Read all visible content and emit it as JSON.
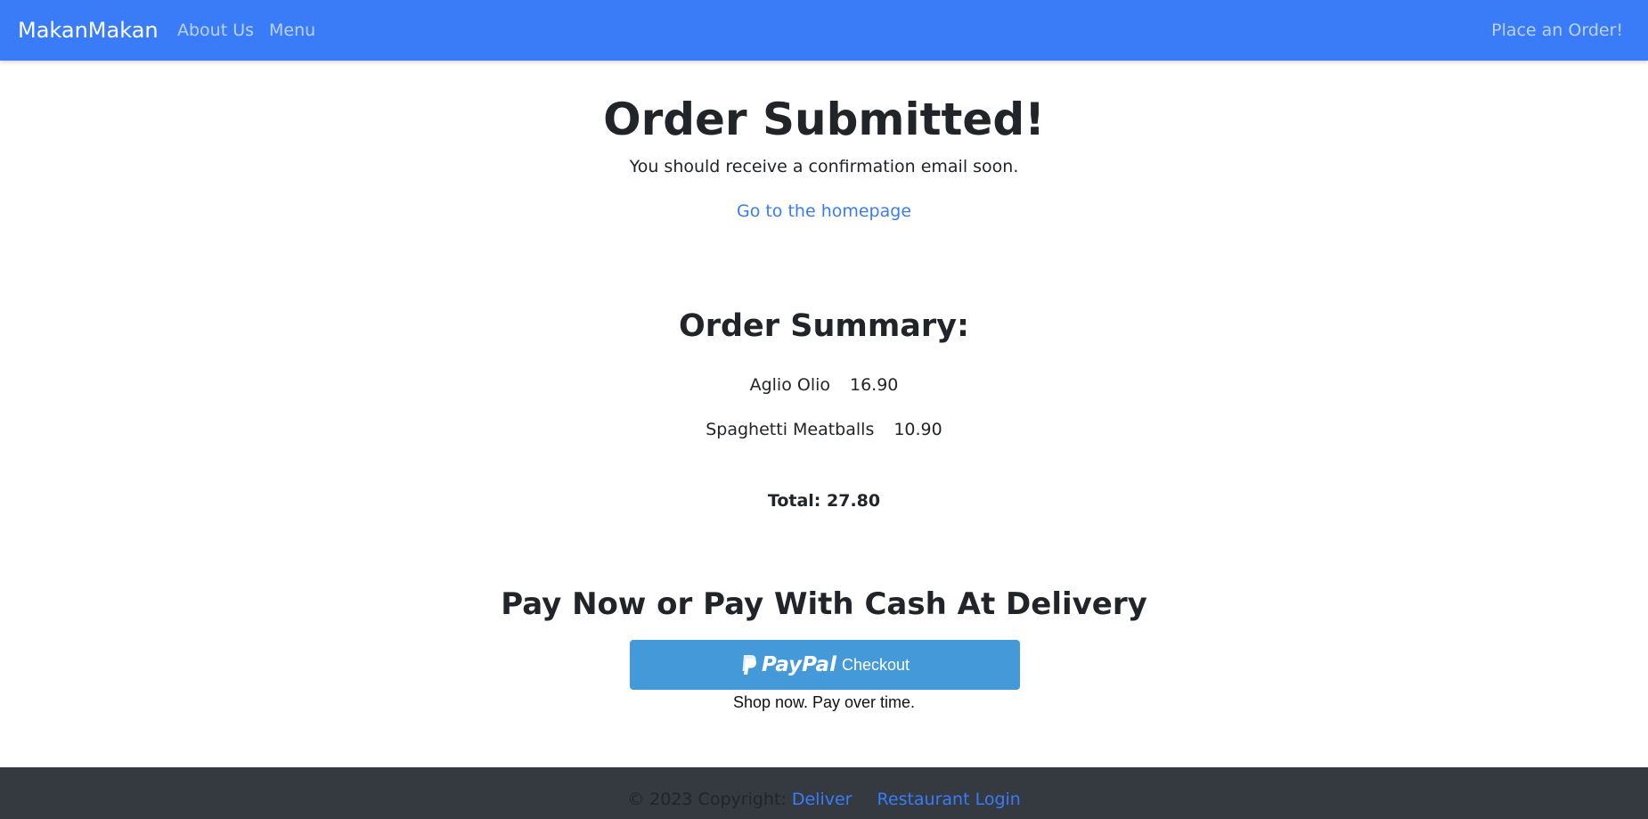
{
  "navbar": {
    "brand": "MakanMakan",
    "links": [
      "About Us",
      "Menu"
    ],
    "cta": "Place an Order!"
  },
  "confirmation": {
    "title": "Order Submitted!",
    "message": "You should receive a confirmation email soon.",
    "home_link": "Go to the homepage"
  },
  "summary": {
    "title": "Order Summary:",
    "items": [
      {
        "name": "Aglio Olio",
        "price": "16.90"
      },
      {
        "name": "Spaghetti Meatballs",
        "price": "10.90"
      }
    ],
    "total": "Total: 27.80"
  },
  "payment": {
    "title": "Pay Now or Pay With Cash At Delivery",
    "paypal_brand": "PayPal",
    "paypal_label": "Checkout",
    "tagline": "Shop now. Pay over time."
  },
  "footer": {
    "copyright": "© 2023 Copyright:",
    "links": [
      "Deliver",
      "Restaurant Login"
    ]
  },
  "colors": {
    "navbar": "#3a7cf7",
    "paypal_button": "#4499d8",
    "footer": "#343a40",
    "link": "#3a7cf7"
  }
}
